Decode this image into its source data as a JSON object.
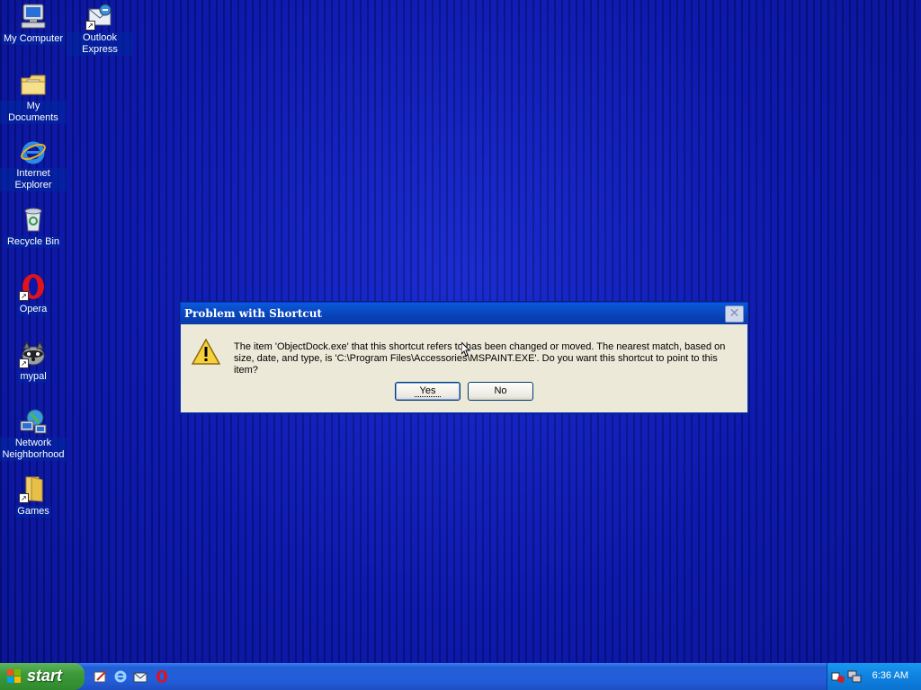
{
  "desktop": {
    "icons": [
      {
        "label": "My Computer",
        "icon": "my-computer-icon"
      },
      {
        "label": "Outlook Express",
        "icon": "outlook-express-icon"
      },
      {
        "label": "My Documents",
        "icon": "my-documents-icon"
      },
      {
        "label": "Internet Explorer",
        "icon": "internet-explorer-icon"
      },
      {
        "label": "Recycle Bin",
        "icon": "recycle-bin-icon"
      },
      {
        "label": "Opera",
        "icon": "opera-icon"
      },
      {
        "label": "mypal",
        "icon": "mypal-icon"
      },
      {
        "label": "Network Neighborhood",
        "icon": "network-neighborhood-icon"
      },
      {
        "label": "Games",
        "icon": "games-folder-icon"
      }
    ]
  },
  "dialog": {
    "title": "Problem with Shortcut",
    "message": "The item 'ObjectDock.exe' that this shortcut refers to has been changed or moved. The nearest match, based on size, date, and type, is 'C:\\Program Files\\Accessories\\MSPAINT.EXE'. Do you want this shortcut to point to this item?",
    "yes_label": "Yes",
    "no_label": "No",
    "icon": "warning-icon"
  },
  "taskbar": {
    "start_label": "start",
    "quick_launch": [
      "paint-icon",
      "internet-explorer-icon",
      "outlook-express-icon",
      "opera-icon"
    ],
    "tray_icons": [
      "volume-icon",
      "network-icon"
    ],
    "clock": "6:36 AM"
  },
  "colors": {
    "desktop": "#0a1496",
    "titlebar": "#0a4cc8",
    "taskbar": "#245edb",
    "start": "#3c9a3a",
    "dialog": "#ece9d8"
  }
}
